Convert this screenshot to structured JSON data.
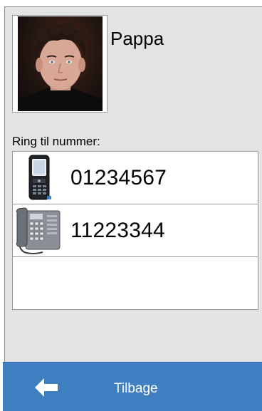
{
  "contact": {
    "name": "Pappa",
    "photo_icon": "contact-photo"
  },
  "numbers_section": {
    "label": "Ring til nummer:",
    "items": [
      {
        "number": "01234567",
        "icon": "mobile-phone-icon"
      },
      {
        "number": "11223344",
        "icon": "desk-phone-icon"
      }
    ]
  },
  "footer": {
    "back_label": "Tilbage",
    "back_icon": "arrow-left-icon"
  },
  "colors": {
    "footer_bg": "#3f7ec0",
    "screen_bg": "#e3e3e3"
  }
}
